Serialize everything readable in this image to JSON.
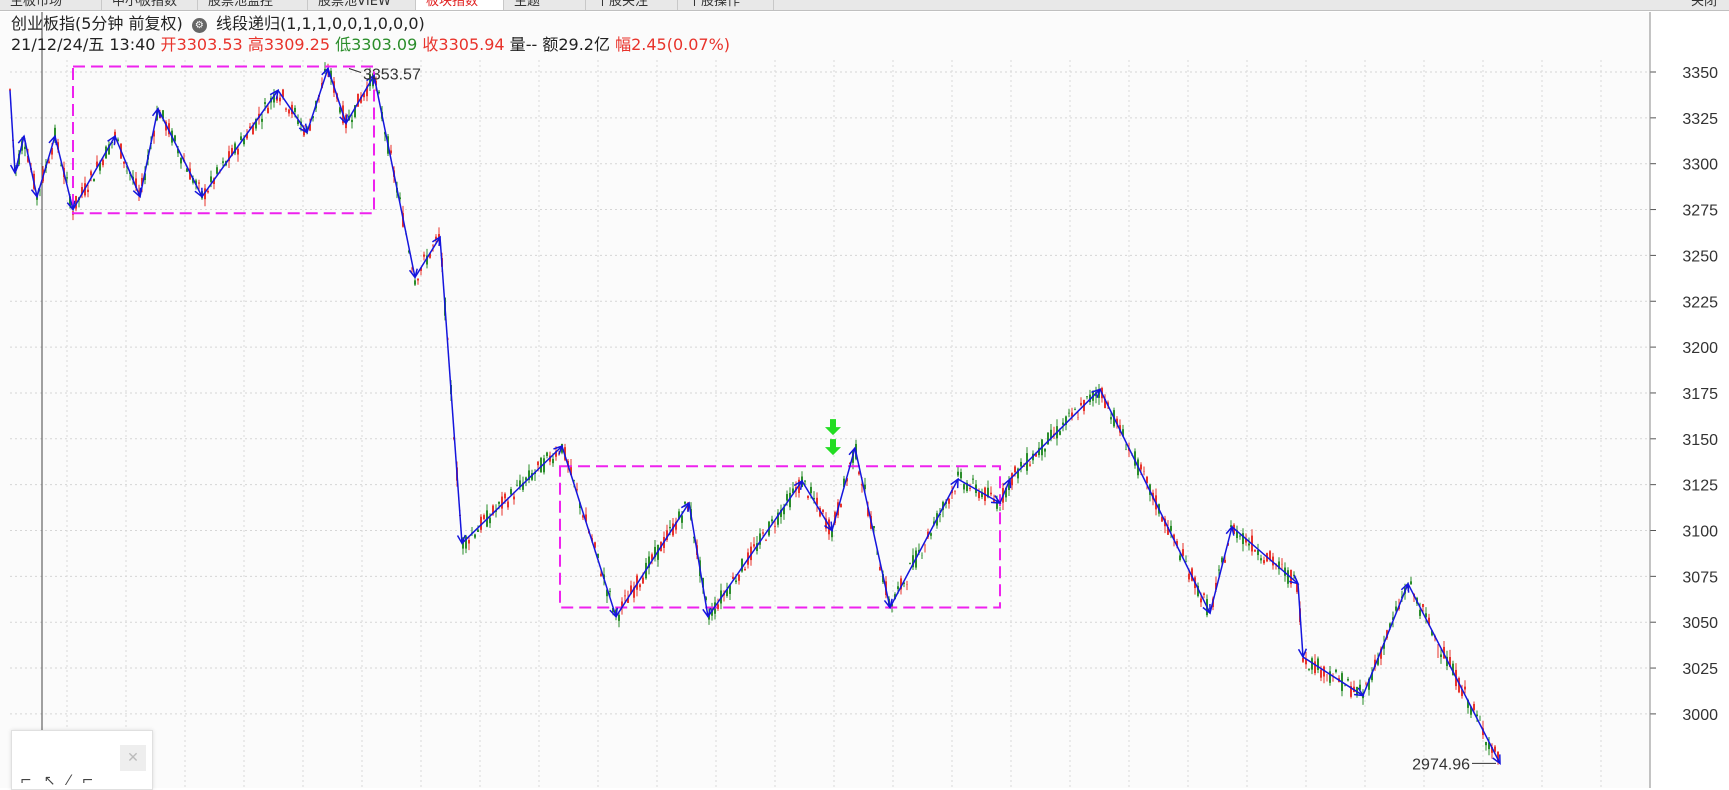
{
  "tabs": [
    {
      "label": "主板市场",
      "active": false
    },
    {
      "label": "中小板指数",
      "active": false
    },
    {
      "label": "股票池监控",
      "active": false
    },
    {
      "label": "股票池VIEW",
      "active": false
    },
    {
      "label": "板块指数",
      "active": true
    },
    {
      "label": "主题",
      "active": false
    },
    {
      "label": "个股关注",
      "active": false
    },
    {
      "label": "个股操作",
      "active": false
    }
  ],
  "close_label": "关闭",
  "header": {
    "name": "创业板指(5分钟 前复权)",
    "indicator": "线段递归(1,1,1,0,0,1,0,0,0)",
    "date": "21/12/24/五 13:40",
    "open_label": "开",
    "open": "3303.53",
    "high_label": "高",
    "high": "3309.25",
    "low_label": "低",
    "low": "3303.09",
    "close_label": "收",
    "close": "3305.94",
    "vol_label": "量",
    "vol": "--",
    "amount_label": "额",
    "amount": "29.2亿",
    "range_label": "幅",
    "range": "2.45(0.07%)"
  },
  "colors": {
    "up": "#e8332b",
    "down": "#2a8d2a",
    "zigzag": "#1515dd",
    "box": "#ee22ee",
    "arrow": "#22dd22"
  },
  "chart_data": {
    "type": "line",
    "title": "创业板指(5分钟 前复权)",
    "y_ticks": [
      3350,
      3325,
      3300,
      3275,
      3250,
      3225,
      3200,
      3175,
      3150,
      3125,
      3100,
      3075,
      3050,
      3025,
      3000
    ],
    "ylim": [
      2971,
      3360
    ],
    "x": [
      0,
      5,
      14,
      27,
      45,
      63,
      105,
      130,
      148,
      192,
      268,
      297,
      318,
      336,
      364,
      405,
      430,
      452,
      552,
      606,
      679,
      698,
      792,
      822,
      845,
      880,
      948,
      990,
      1000,
      1090,
      1200,
      1222,
      1288,
      1293,
      1353,
      1398,
      1490
    ],
    "series": [
      {
        "name": "线段",
        "values": [
          3340,
          3295,
          3315,
          3282,
          3315,
          3275,
          3315,
          3282,
          3330,
          3282,
          3340,
          3317,
          3352,
          3322,
          3348,
          3238,
          3260,
          3093,
          3146,
          3053,
          3115,
          3053,
          3127,
          3100,
          3145,
          3058,
          3128,
          3115,
          3128,
          3177,
          3055,
          3102,
          3071,
          3031,
          3010,
          3071,
          2973
        ]
      }
    ],
    "boxes": [
      {
        "x0": 63,
        "x1": 364,
        "y_high": 3353,
        "y_low": 3273
      },
      {
        "x0": 550,
        "x1": 990,
        "y_high": 3135,
        "y_low": 3058
      }
    ],
    "annotations": [
      {
        "label": "3353.57",
        "x": 335,
        "y": 3353
      },
      {
        "label": "2974.96",
        "x": 1490,
        "y": 2973
      }
    ],
    "signals": [
      {
        "type": "sell",
        "x": 823,
        "y": 3140
      }
    ]
  }
}
